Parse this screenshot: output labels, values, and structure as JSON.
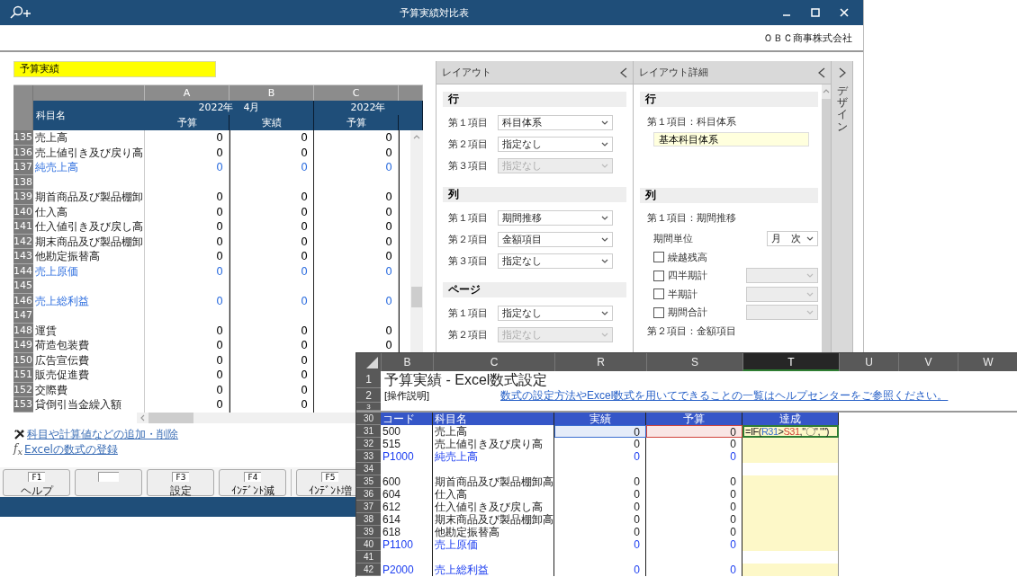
{
  "window": {
    "title": "予算実績対比表",
    "company": "ＯＢＣ商事株式会社"
  },
  "report_name": "予算実績",
  "grid": {
    "column_letters": [
      "A",
      "B",
      "C"
    ],
    "name_header": "科目名",
    "periods": [
      {
        "label": "2022年　4月",
        "measures": [
          "予算",
          "実績"
        ]
      },
      {
        "label": "2022年",
        "measures": [
          "予算"
        ]
      }
    ],
    "rows": [
      {
        "num": "135",
        "name": "売上高",
        "kind": "item",
        "values": [
          "0",
          "0",
          "0"
        ]
      },
      {
        "num": "136",
        "name": "売上値引き及び戻り高",
        "kind": "item",
        "values": [
          "0",
          "0",
          "0"
        ]
      },
      {
        "num": "137",
        "name": "純売上高",
        "kind": "total",
        "values": [
          "0",
          "0",
          "0"
        ]
      },
      {
        "num": "138",
        "kind": "blank"
      },
      {
        "num": "139",
        "name": "期首商品及び製品棚卸",
        "kind": "item",
        "values": [
          "0",
          "0",
          "0"
        ]
      },
      {
        "num": "140",
        "name": "仕入高",
        "kind": "item",
        "values": [
          "0",
          "0",
          "0"
        ]
      },
      {
        "num": "141",
        "name": "仕入値引き及び戻し高",
        "kind": "item",
        "values": [
          "0",
          "0",
          "0"
        ]
      },
      {
        "num": "142",
        "name": "期末商品及び製品棚卸",
        "kind": "item",
        "values": [
          "0",
          "0",
          "0"
        ]
      },
      {
        "num": "143",
        "name": "他勘定振替高",
        "kind": "item",
        "values": [
          "0",
          "0",
          "0"
        ]
      },
      {
        "num": "144",
        "name": "売上原価",
        "kind": "total",
        "values": [
          "0",
          "0",
          "0"
        ]
      },
      {
        "num": "145",
        "kind": "blank"
      },
      {
        "num": "146",
        "name": "売上総利益",
        "kind": "total",
        "values": [
          "0",
          "0",
          "0"
        ]
      },
      {
        "num": "147",
        "kind": "blank"
      },
      {
        "num": "148",
        "name": "運賃",
        "kind": "item",
        "values": [
          "0",
          "0",
          "0"
        ]
      },
      {
        "num": "149",
        "name": "荷造包装費",
        "kind": "item",
        "values": [
          "0",
          "0",
          "0"
        ]
      },
      {
        "num": "150",
        "name": "広告宣伝費",
        "kind": "item",
        "values": [
          "0",
          "0"
        ]
      },
      {
        "num": "151",
        "name": "販売促進費",
        "kind": "item",
        "values": [
          "0",
          "0"
        ]
      },
      {
        "num": "152",
        "name": "交際費",
        "kind": "item",
        "values": [
          "0",
          "0"
        ]
      },
      {
        "num": "153",
        "name": "貸倒引当金繰入額",
        "kind": "item",
        "values": [
          "0",
          "0"
        ]
      }
    ]
  },
  "links": [
    {
      "kind": "wrench",
      "text": "科目や計算値などの追加・削除"
    },
    {
      "kind": "fx",
      "icon": "f$_{x}$",
      "text": "Excelの数式の登録"
    }
  ],
  "function_keys": [
    {
      "kind": "key",
      "key": "F1",
      "label": "ヘルプ"
    },
    {
      "kind": "empty"
    },
    {
      "kind": "key",
      "key": "F3",
      "label": "設定"
    },
    {
      "kind": "key",
      "key": "F4",
      "label": "ｲﾝﾃﾞﾝﾄ減"
    },
    {
      "kind": "separator"
    },
    {
      "kind": "key",
      "key": "F5",
      "label": "ｲﾝﾃﾞﾝﾄ増"
    }
  ],
  "layout_panel": {
    "title": "レイアウト",
    "sections": [
      {
        "title": "行",
        "items": [
          {
            "label": "第１項目",
            "value": "科目体系",
            "disabled": false
          },
          {
            "label": "第２項目",
            "value": "指定なし",
            "disabled": false
          },
          {
            "label": "第３項目",
            "value": "指定なし",
            "disabled": true
          }
        ]
      },
      {
        "title": "列",
        "items": [
          {
            "label": "第１項目",
            "value": "期間推移",
            "disabled": false
          },
          {
            "label": "第２項目",
            "value": "金額項目",
            "disabled": false
          },
          {
            "label": "第３項目",
            "value": "指定なし",
            "disabled": false
          }
        ]
      },
      {
        "title": "ページ",
        "items": [
          {
            "label": "第１項目",
            "value": "指定なし",
            "disabled": false
          },
          {
            "label": "第２項目",
            "value": "指定なし",
            "disabled": true
          }
        ]
      }
    ]
  },
  "detail_panel": {
    "title": "レイアウト詳細",
    "sections": [
      {
        "title": "行",
        "entries": [
          {
            "kind": "caption",
            "text": "第１項目：科目体系"
          },
          {
            "kind": "readonly_field",
            "value": "基本科目体系"
          }
        ]
      },
      {
        "title": "列",
        "entries": [
          {
            "kind": "caption",
            "text": "第１項目：期間推移"
          },
          {
            "kind": "select_row",
            "label": "期間単位",
            "value": "月　次"
          },
          {
            "kind": "checkbox",
            "label": "繰越残高",
            "checked": false,
            "has_select": false
          },
          {
            "kind": "checkbox",
            "label": "四半期計",
            "checked": false,
            "has_select": true
          },
          {
            "kind": "checkbox",
            "label": "半期計",
            "checked": false,
            "has_select": true
          },
          {
            "kind": "checkbox",
            "label": "期間合計",
            "checked": false,
            "has_select": true
          },
          {
            "kind": "caption",
            "text": "第２項目：金額項目"
          }
        ]
      }
    ]
  },
  "design_tab": {
    "label": "デザイン"
  },
  "excel": {
    "columns": [
      {
        "label": "B",
        "selected": false
      },
      {
        "label": "C",
        "selected": false
      },
      {
        "label": "R",
        "selected": false
      },
      {
        "label": "S",
        "selected": false
      },
      {
        "label": "T",
        "selected": true
      },
      {
        "label": "U",
        "selected": false
      },
      {
        "label": "V",
        "selected": false
      },
      {
        "label": "W",
        "selected": false
      }
    ],
    "title_row": "1",
    "title": "予算実績 - Excel数式設定",
    "note_row": "2",
    "note": "[操作説明]",
    "help_link": "数式の設定方法やExcel数式を用いてできることの一覧はヘルプセンターをご参照ください。",
    "spacer_row": "3",
    "header": {
      "row": "30",
      "cells": [
        "コード",
        "科目名",
        "実績",
        "予算",
        "達成"
      ]
    },
    "rows": [
      {
        "row": "31",
        "kind": "item",
        "code": "500",
        "name": "売上高",
        "actual": "0",
        "budget": "0",
        "selected": true,
        "formula": [
          {
            "text": "=IF("
          },
          {
            "text": "R31",
            "color": "#3b6fd0"
          },
          {
            "text": ">"
          },
          {
            "text": "S31",
            "color": "#d0443b"
          },
          {
            "text": ",\"〇\",\"\")"
          }
        ]
      },
      {
        "row": "32",
        "kind": "item",
        "code": "515",
        "name": "売上値引き及び戻り高",
        "actual": "0",
        "budget": "0",
        "selected": false
      },
      {
        "row": "33",
        "kind": "total",
        "code": "P1000",
        "name": "純売上高",
        "actual": "0",
        "budget": "0",
        "selected": false
      },
      {
        "row": "34",
        "kind": "blank",
        "selected": false
      },
      {
        "row": "35",
        "kind": "item",
        "code": "600",
        "name": "期首商品及び製品棚卸高",
        "actual": "0",
        "budget": "0",
        "selected": false
      },
      {
        "row": "36",
        "kind": "item",
        "code": "604",
        "name": "仕入高",
        "actual": "0",
        "budget": "0",
        "selected": false
      },
      {
        "row": "37",
        "kind": "item",
        "code": "612",
        "name": "仕入値引き及び戻し高",
        "actual": "0",
        "budget": "0",
        "selected": false
      },
      {
        "row": "38",
        "kind": "item",
        "code": "614",
        "name": "期末商品及び製品棚卸高",
        "actual": "0",
        "budget": "0",
        "selected": false
      },
      {
        "row": "39",
        "kind": "item",
        "code": "618",
        "name": "他勘定振替高",
        "actual": "0",
        "budget": "0",
        "selected": false
      },
      {
        "row": "40",
        "kind": "total",
        "code": "P1100",
        "name": "売上原価",
        "actual": "0",
        "budget": "0",
        "selected": false
      },
      {
        "row": "41",
        "kind": "blank",
        "selected": false
      },
      {
        "row": "42",
        "kind": "total",
        "code": "P2000",
        "name": "売上総利益",
        "actual": "0",
        "budget": "0",
        "selected": false
      }
    ]
  }
}
